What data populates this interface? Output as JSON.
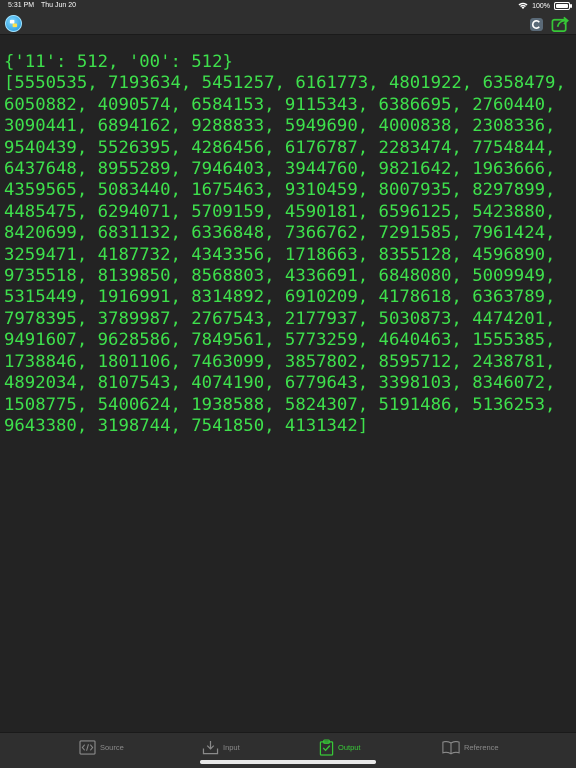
{
  "status_bar": {
    "time": "5:31 PM",
    "date": "Thu Jun 20",
    "battery": "100%"
  },
  "navbar": {
    "app_icon": "python-app-icon",
    "clear_icon": "clear-icon",
    "share_icon": "share-icon",
    "share_color": "#37c837"
  },
  "output": {
    "text": "{'11': 512, '00': 512}\n[5550535, 7193634, 5451257, 6161773, 4801922, 6358479, 6050882, 4090574, 6584153, 9115343, 6386695, 2760440, 3090441, 6894162, 9288833, 5949690, 4000838, 2308336, 9540439, 5526395, 4286456, 6176787, 2283474, 7754844, 6437648, 8955289, 7946403, 3944760, 9821642, 1963666, 4359565, 5083440, 1675463, 9310459, 8007935, 8297899, 4485475, 6294071, 5709159, 4590181, 6596125, 5423880, 8420699, 6831132, 6336848, 7366762, 7291585, 7961424, 3259471, 4187732, 4343356, 1718663, 8355128, 4596890, 9735518, 8139850, 8568803, 4336691, 6848080, 5009949, 5315449, 1916991, 8314892, 6910209, 4178618, 6363789, 7978395, 3789987, 2767543, 2177937, 5030873, 4474201, 9491607, 9628586, 7849561, 5773259, 4640463, 1555385, 1738846, 1801106, 7463099, 3857802, 8595712, 2438781, 4892034, 8107543, 4074190, 6779643, 3398103, 8346072, 1508775, 5400624, 1938588, 5824307, 5191486, 5136253, 9643380, 3198744, 7541850, 4131342]",
    "color": "#3ee04c"
  },
  "tabs": [
    {
      "label": "Source",
      "icon": "code-icon"
    },
    {
      "label": "Input",
      "icon": "input-tray-icon"
    },
    {
      "label": "Output",
      "icon": "output-clipboard-icon",
      "active": true
    },
    {
      "label": "Reference",
      "icon": "book-icon"
    }
  ]
}
